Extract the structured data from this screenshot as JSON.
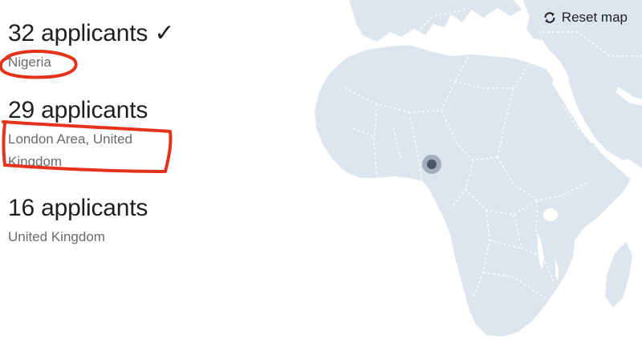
{
  "results": [
    {
      "count_label": "32 applicants",
      "check": "✓",
      "location": "Nigeria"
    },
    {
      "count_label": "29 applicants",
      "location": "London Area, United Kingdom"
    },
    {
      "count_label": "16 applicants",
      "location": "United Kingdom"
    }
  ],
  "map": {
    "reset_label": "Reset map",
    "land_color": "#dde5ef",
    "border_color": "#ffffff",
    "marker_color": "#4a5866"
  },
  "annotations": {
    "color": "#e5331b"
  }
}
